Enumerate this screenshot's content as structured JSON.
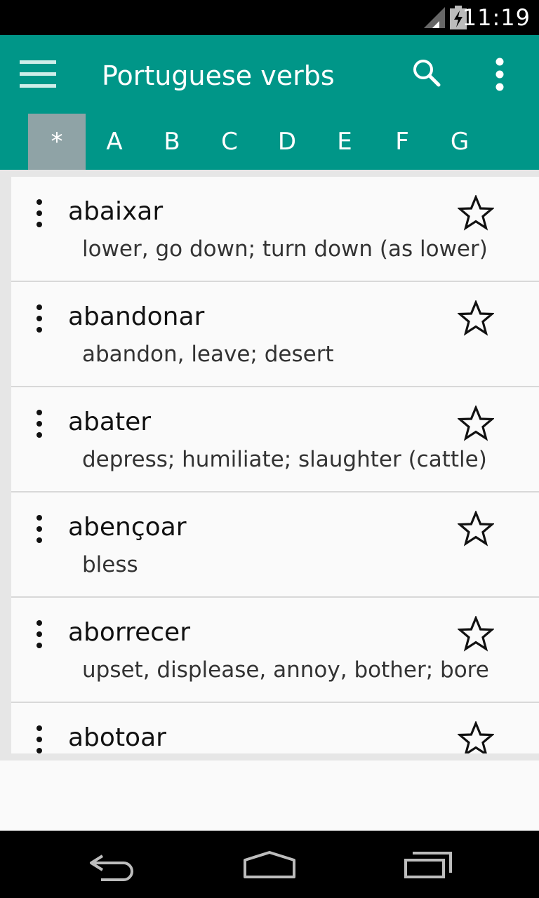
{
  "status_bar": {
    "time": "11:19"
  },
  "app_bar": {
    "title": "Portuguese verbs",
    "background_color": "#009688"
  },
  "tabs": [
    {
      "label": "*",
      "selected": true
    },
    {
      "label": "A"
    },
    {
      "label": "B"
    },
    {
      "label": "C"
    },
    {
      "label": "D"
    },
    {
      "label": "E"
    },
    {
      "label": "F"
    },
    {
      "label": "G"
    }
  ],
  "verbs": [
    {
      "verb": "abaixar",
      "meaning": "lower, go down; turn down (as lower)"
    },
    {
      "verb": "abandonar",
      "meaning": "abandon, leave; desert"
    },
    {
      "verb": "abater",
      "meaning": "depress; humiliate; slaughter (cattle)"
    },
    {
      "verb": "abençoar",
      "meaning": "bless"
    },
    {
      "verb": "aborrecer",
      "meaning": "upset, displease, annoy, bother; bore"
    },
    {
      "verb": "abotoar",
      "meaning": ""
    }
  ],
  "icons": {
    "menu": "menu-icon",
    "search": "search-icon",
    "overflow": "overflow-menu-icon",
    "row_menu": "more-vert-icon",
    "favorite": "star-outline-icon",
    "back": "back-icon",
    "home": "home-icon",
    "recents": "recents-icon"
  }
}
